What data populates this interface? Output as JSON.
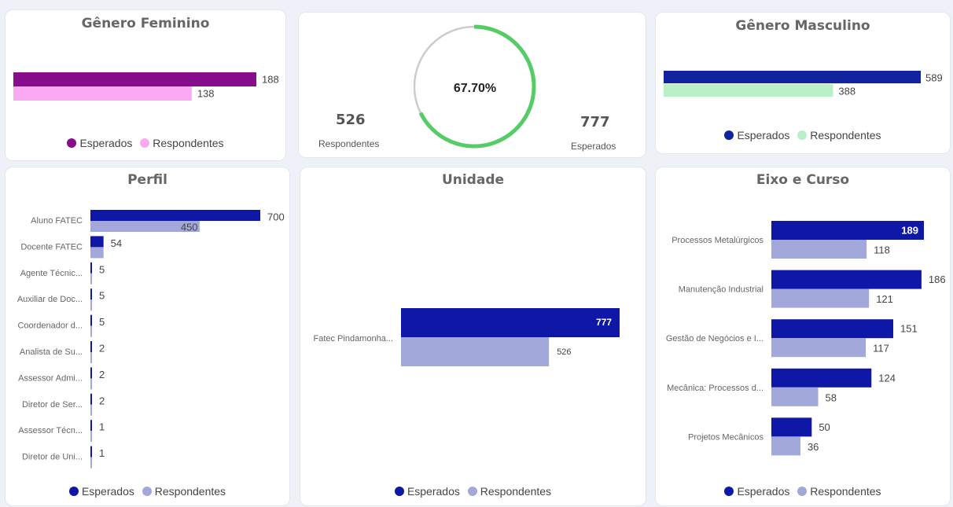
{
  "colors": {
    "fem_esperados": "#870d8c",
    "fem_respondentes": "#f9aaf1",
    "masc_esperados": "#12239e",
    "masc_respondentes": "#b8f0c8",
    "esperados": "#0f17a6",
    "respondentes": "#a3a8da",
    "gauge_fill": "#55cc66",
    "gauge_track": "#cccccc"
  },
  "legend": {
    "esperados": "Esperados",
    "respondentes": "Respondentes"
  },
  "gauge": {
    "value_label": "67.70%",
    "respondentes_value": "526",
    "respondentes_label": "Respondentes",
    "esperados_value": "777",
    "esperados_label": "Esperados"
  },
  "chart_data": [
    {
      "id": "feminino",
      "type": "bar",
      "title": "Gênero Feminino",
      "series": [
        {
          "name": "Esperados",
          "values": [
            188
          ]
        },
        {
          "name": "Respondentes",
          "values": [
            138
          ]
        }
      ]
    },
    {
      "id": "gauge",
      "type": "gauge",
      "value": 526,
      "max": 777,
      "percent": 67.7
    },
    {
      "id": "masculino",
      "type": "bar",
      "title": "Gênero Masculino",
      "series": [
        {
          "name": "Esperados",
          "values": [
            589
          ]
        },
        {
          "name": "Respondentes",
          "values": [
            388
          ]
        }
      ]
    },
    {
      "id": "perfil",
      "type": "bar",
      "title": "Perfil",
      "categories": [
        "Aluno FATEC",
        "Docente FATEC",
        "Agente Técnic...",
        "Auxiliar de Doc...",
        "Coordenador d...",
        "Analista de Su...",
        "Assessor Admi...",
        "Diretor de Ser...",
        "Assessor Técn...",
        "Diretor de Uni..."
      ],
      "series": [
        {
          "name": "Esperados",
          "values": [
            700,
            54,
            5,
            5,
            5,
            2,
            2,
            2,
            1,
            1
          ]
        },
        {
          "name": "Respondentes",
          "values": [
            450,
            54,
            5,
            5,
            5,
            2,
            2,
            2,
            1,
            1
          ]
        }
      ],
      "labels": {
        "Esperados": [
          "700",
          "54",
          "5",
          "5",
          "5",
          "2",
          "2",
          "2",
          "1",
          "1"
        ],
        "Respondentes": [
          "450",
          "",
          "",
          "",
          "",
          "",
          "",
          "",
          "",
          ""
        ]
      }
    },
    {
      "id": "unidade",
      "type": "bar",
      "title": "Unidade",
      "categories": [
        "Fatec Pindamonha..."
      ],
      "series": [
        {
          "name": "Esperados",
          "values": [
            777
          ]
        },
        {
          "name": "Respondentes",
          "values": [
            526
          ]
        }
      ]
    },
    {
      "id": "eixo",
      "type": "bar",
      "title": "Eixo e Curso",
      "categories": [
        "Processos Metalúrgicos",
        "Manutenção Industrial",
        "Gestão de Negócios e I...",
        "Mecânica: Processos d...",
        "Projetos Mecânicos"
      ],
      "series": [
        {
          "name": "Esperados",
          "values": [
            189,
            186,
            151,
            124,
            50
          ]
        },
        {
          "name": "Respondentes",
          "values": [
            118,
            121,
            117,
            58,
            36
          ]
        }
      ]
    }
  ]
}
